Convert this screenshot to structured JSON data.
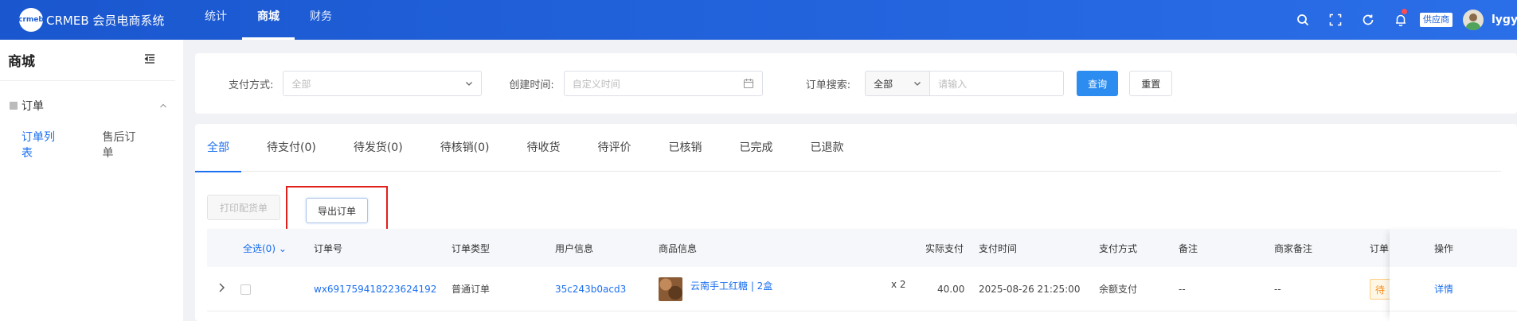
{
  "header": {
    "logo_badge": "crmeb",
    "brand": "CRMEB 会员电商系统",
    "nav": [
      {
        "label": "统计"
      },
      {
        "label": "商城"
      },
      {
        "label": "财务"
      }
    ],
    "icons": [
      "search-icon",
      "fullscreen-icon",
      "refresh-icon",
      "bell-icon"
    ],
    "role_badge": "供应商",
    "username": "lygys"
  },
  "sidebar": {
    "title": "商城",
    "group": "订单",
    "items": [
      {
        "label": "订单列表"
      },
      {
        "label": "售后订单"
      }
    ]
  },
  "filter": {
    "pay_label": "支付方式:",
    "pay_value": "全部",
    "time_label": "创建时间:",
    "time_placeholder": "自定义时间",
    "search_label": "订单搜索:",
    "search_type": "全部",
    "search_placeholder": "请输入",
    "query_btn": "查询",
    "reset_btn": "重置"
  },
  "tabs": [
    {
      "label": "全部"
    },
    {
      "label": "待支付(0)"
    },
    {
      "label": "待发货(0)"
    },
    {
      "label": "待核销(0)"
    },
    {
      "label": "待收货"
    },
    {
      "label": "待评价"
    },
    {
      "label": "已核销"
    },
    {
      "label": "已完成"
    },
    {
      "label": "已退款"
    }
  ],
  "actions": {
    "print_btn": "打印配货单",
    "export_btn": "导出订单"
  },
  "table": {
    "headers": {
      "select_all": "全选(0)",
      "order_no": "订单号",
      "order_type": "订单类型",
      "user_info": "用户信息",
      "product_info": "商品信息",
      "paid": "实际支付",
      "pay_time": "支付时间",
      "pay_method": "支付方式",
      "remark": "备注",
      "merchant_remark": "商家备注",
      "order_status": "订单",
      "operation": "操作"
    },
    "rows": [
      {
        "order_no": "wx691759418223624192",
        "order_type": "普通订单",
        "user": "35c243b0acd3",
        "product": "云南手工红糖 | 2盒",
        "qty": "x 2",
        "paid": "40.00",
        "pay_time": "2025-08-26 21:25:00",
        "pay_method": "余额支付",
        "remark": "--",
        "merchant_remark": "--",
        "status": "待",
        "action": "详情"
      }
    ]
  },
  "colors": {
    "header_blue": "#1b5ed6",
    "primary": "#2d8cf0",
    "link": "#1b6ff0",
    "highlight_border": "#e0201a"
  }
}
